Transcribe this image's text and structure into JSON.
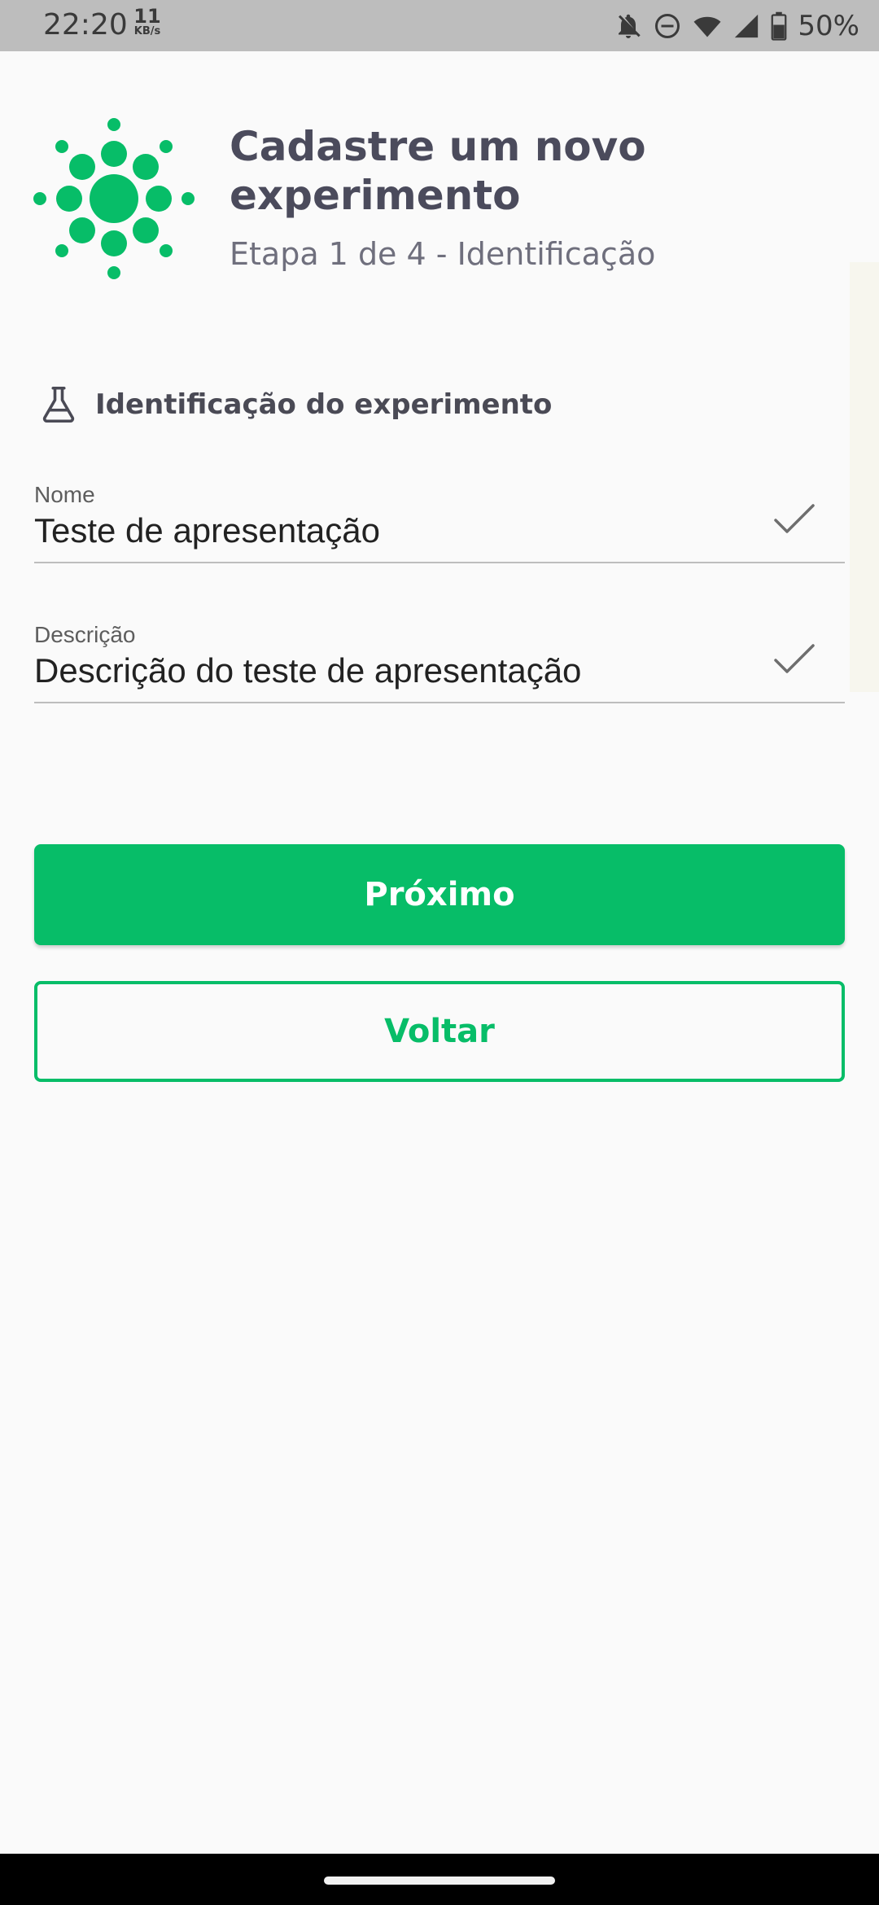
{
  "status_bar": {
    "time": "22:20",
    "net_speed_value": "11",
    "net_speed_unit": "KB/s",
    "battery": "50%",
    "icons": [
      "notifications-off-icon",
      "do-not-disturb-icon",
      "wifi-icon",
      "signal-icon",
      "battery-icon"
    ]
  },
  "header": {
    "logo": "sunburst-logo",
    "title": "Cadastre um novo experimento",
    "subtitle": "Etapa 1 de 4 - Identificação"
  },
  "section": {
    "icon": "flask-icon",
    "title": "Identificação do experimento"
  },
  "fields": [
    {
      "label": "Nome",
      "value": "Teste de apresentação",
      "valid": true
    },
    {
      "label": "Descrição",
      "value": "Descrição do teste de apresentação",
      "valid": true
    }
  ],
  "buttons": {
    "next": "Próximo",
    "back": "Voltar"
  },
  "colors": {
    "brand": "#07bd68",
    "title": "#4b4b5c",
    "subtitle": "#6f6f7d"
  }
}
